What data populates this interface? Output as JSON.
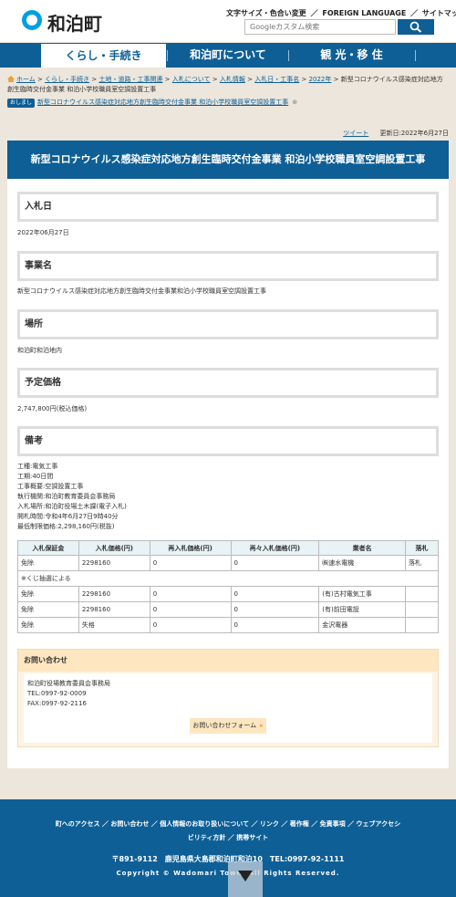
{
  "header": {
    "site_name": "和泊町",
    "util_text_size": "文字サイズ・色合い変更",
    "util_sep1": "／",
    "util_foreign": "FOREIGN LANGUAGE",
    "util_sep2": "／",
    "util_sitemap": "サイトマップ",
    "search_placeholder": "Googleカスタム検索"
  },
  "nav": {
    "items": [
      "くらし・手続き",
      "和泊町について",
      "観 光・移 住"
    ]
  },
  "breadcrumb": {
    "items": [
      "ホーム",
      "くらし・手続き",
      "土地・道路・工事関連",
      "入札について",
      "入札情報",
      "入札日・工事名",
      "2022年"
    ],
    "current": "新型コロナウイルス感染症対応地方創生臨時交付金事業 和泊小学校職員室空調設置工事"
  },
  "related": {
    "badge": "おしまし",
    "link": "新型コロナウイルス感染症対応地方創生臨時交付金事業 和泊小学校職員室空調設置工事",
    "close": "⊗"
  },
  "meta": {
    "tweet": "ツイート",
    "updated": "更新日:2022年6月27日"
  },
  "page_title": "新型コロナウイルス感染症対応地方創生臨時交付金事業 和泊小学校職員室空調設置工事",
  "sections": {
    "date": {
      "heading": "入札日",
      "value": "2022年06月27日"
    },
    "project": {
      "heading": "事業名",
      "value": "新型コロナウイルス感染症対応地方創生臨時交付金事業和泊小学校職員室空調設置工事"
    },
    "place": {
      "heading": "場所",
      "value": "和泊町和泊地内"
    },
    "price": {
      "heading": "予定価格",
      "value": "2,747,800円(税込価格)"
    },
    "remarks": {
      "heading": "備考"
    }
  },
  "notes": [
    "工種:電気工事",
    "工期:40日間",
    "工事概要:空調設置工事",
    "執行機関:和泊町教育委員会事務局",
    "入札場所:和泊町役場土木課(電子入札)",
    "開札時間:令和4年6月27日9時40分",
    "最低制限価格:2,298,160円(税抜)"
  ],
  "table": {
    "headers": [
      "入札保証金",
      "入札価格(円)",
      "再入札価格(円)",
      "再々入札価格(円)",
      "業者名",
      "落札"
    ],
    "rows": [
      [
        "免除",
        "2298160",
        "0",
        "0",
        "㈱速水電機",
        "落札"
      ],
      [
        "免除",
        "2298160",
        "0",
        "0",
        "(有)古村電気工事",
        ""
      ],
      [
        "免除",
        "2298160",
        "0",
        "0",
        "(有)前田電設",
        ""
      ],
      [
        "免除",
        "失格",
        "0",
        "0",
        "金沢電器",
        ""
      ]
    ],
    "note": "※くじ抽選による"
  },
  "contact": {
    "heading": "お問い合わせ",
    "lines": [
      "和泊町役場教育委員会事務局",
      "TEL:0997-92-0009",
      "FAX:0997-92-2116"
    ],
    "button": "お問い合わせフォーム"
  },
  "footer": {
    "links": [
      "町へのアクセス",
      "お問い合わせ",
      "個人情報のお取り扱いについて",
      "リンク",
      "著作権",
      "免責事項",
      "ウェブアクセシビリティ方針",
      "携帯サイト"
    ],
    "address": "〒891-9112　鹿児島県大島郡和泊町和泊10　TEL:0997-92-1111",
    "copyright": "Copyright © Wadomari Town. All Rights Reserved."
  },
  "colors": {
    "primary": "#0e5f96",
    "accent": "#f0a030",
    "background": "#ece6dc"
  }
}
